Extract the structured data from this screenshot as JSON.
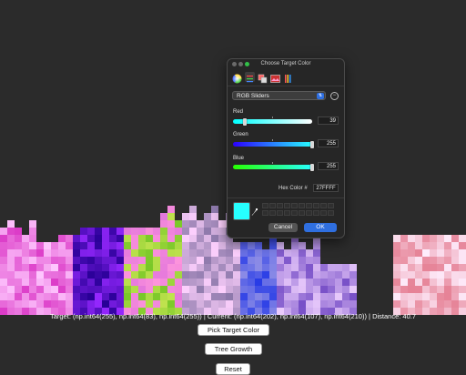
{
  "status_text": "Target: (np.int64(255), np.int64(83), np.int64(255)) | Current: (np.int64(202), np.int64(107), np.int64(210)) | Distance: 40.7",
  "buttons": {
    "pick": "Pick Target Color",
    "tree": "Tree Growth",
    "reset": "Reset"
  },
  "dialog": {
    "title": "Choose Target Color",
    "toolbar_icons": [
      "color-wheel-icon",
      "sliders-icon",
      "palettes-icon",
      "image-palettes-icon",
      "pencils-icon"
    ],
    "mode": "RGB Sliders",
    "sliders": [
      {
        "label": "Red",
        "value": "39",
        "level": 0.153
      },
      {
        "label": "Green",
        "value": "255",
        "level": 1.0
      },
      {
        "label": "Blue",
        "value": "255",
        "level": 1.0
      }
    ],
    "hex_label": "Hex Color #",
    "hex_value": "27FFFF",
    "current_color": "#27ffff",
    "cancel_label": "Cancel",
    "ok_label": "OK"
  },
  "colors": {
    "background": "#2b2b2b",
    "accent": "#2f6fe0"
  }
}
